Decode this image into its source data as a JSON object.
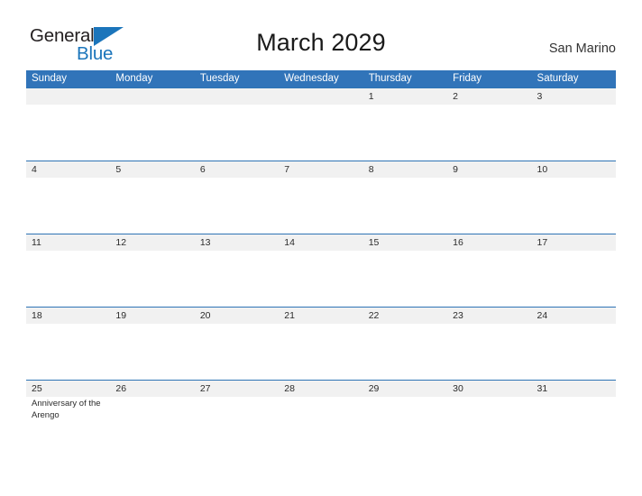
{
  "brand": {
    "name_part1": "General",
    "name_part2": "Blue",
    "color_dark": "#231f20",
    "color_blue": "#1b75bb",
    "triangle_icon": "triangle-icon"
  },
  "header": {
    "title": "March 2029",
    "location": "San Marino",
    "accent_color": "#3174b9",
    "band_color": "#f1f1f1",
    "rule_color": "#2e74b5"
  },
  "calendar": {
    "weekdays": [
      "Sunday",
      "Monday",
      "Tuesday",
      "Wednesday",
      "Thursday",
      "Friday",
      "Saturday"
    ],
    "weeks": [
      {
        "days": [
          {
            "num": "",
            "event": ""
          },
          {
            "num": "",
            "event": ""
          },
          {
            "num": "",
            "event": ""
          },
          {
            "num": "",
            "event": ""
          },
          {
            "num": "1",
            "event": ""
          },
          {
            "num": "2",
            "event": ""
          },
          {
            "num": "3",
            "event": ""
          }
        ]
      },
      {
        "days": [
          {
            "num": "4",
            "event": ""
          },
          {
            "num": "5",
            "event": ""
          },
          {
            "num": "6",
            "event": ""
          },
          {
            "num": "7",
            "event": ""
          },
          {
            "num": "8",
            "event": ""
          },
          {
            "num": "9",
            "event": ""
          },
          {
            "num": "10",
            "event": ""
          }
        ]
      },
      {
        "days": [
          {
            "num": "11",
            "event": ""
          },
          {
            "num": "12",
            "event": ""
          },
          {
            "num": "13",
            "event": ""
          },
          {
            "num": "14",
            "event": ""
          },
          {
            "num": "15",
            "event": ""
          },
          {
            "num": "16",
            "event": ""
          },
          {
            "num": "17",
            "event": ""
          }
        ]
      },
      {
        "days": [
          {
            "num": "18",
            "event": ""
          },
          {
            "num": "19",
            "event": ""
          },
          {
            "num": "20",
            "event": ""
          },
          {
            "num": "21",
            "event": ""
          },
          {
            "num": "22",
            "event": ""
          },
          {
            "num": "23",
            "event": ""
          },
          {
            "num": "24",
            "event": ""
          }
        ]
      },
      {
        "days": [
          {
            "num": "25",
            "event": "Anniversary of the Arengo"
          },
          {
            "num": "26",
            "event": ""
          },
          {
            "num": "27",
            "event": ""
          },
          {
            "num": "28",
            "event": ""
          },
          {
            "num": "29",
            "event": ""
          },
          {
            "num": "30",
            "event": ""
          },
          {
            "num": "31",
            "event": ""
          }
        ]
      }
    ]
  }
}
